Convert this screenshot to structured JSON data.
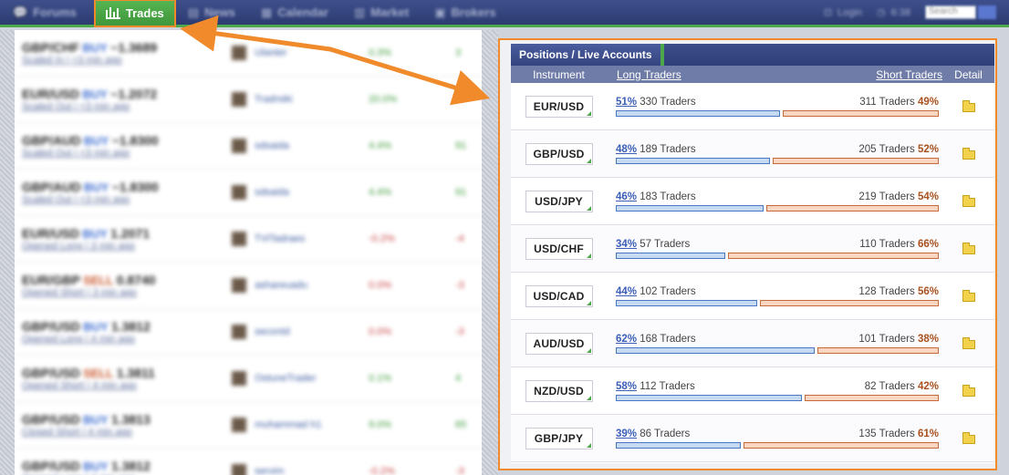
{
  "nav": {
    "items": [
      {
        "label": "Forums",
        "icon": "chat-icon",
        "active": false
      },
      {
        "label": "Trades",
        "icon": "bar-chart-icon",
        "active": true
      },
      {
        "label": "News",
        "icon": "news-icon",
        "active": false
      },
      {
        "label": "Calendar",
        "icon": "calendar-icon",
        "active": false
      },
      {
        "label": "Market",
        "icon": "market-icon",
        "active": false
      },
      {
        "label": "Brokers",
        "icon": "brokers-icon",
        "active": false
      }
    ],
    "login": "Login",
    "time": "6:38",
    "search_placeholder": "Search"
  },
  "feed": [
    {
      "pair": "GBP/CHF",
      "dir": "BUY",
      "price": "~1.3689",
      "sub": "Scaled In | <3 min ago",
      "user": "Ulanter",
      "pct": "0.3%",
      "pips": "3",
      "sign": "pos"
    },
    {
      "pair": "EUR/USD",
      "dir": "BUY",
      "price": "~1.2072",
      "sub": "Scaled Out | <3 min ago",
      "user": "Tradrsiki",
      "pct": "20.0%",
      "pips": "",
      "sign": "pos"
    },
    {
      "pair": "GBP/AUD",
      "dir": "BUY",
      "price": "~1.8300",
      "sub": "Scaled Out | <3 min ago",
      "user": "sdsaida",
      "pct": "4.4%",
      "pips": "91",
      "sign": "pos"
    },
    {
      "pair": "GBP/AUD",
      "dir": "BUY",
      "price": "~1.8300",
      "sub": "Scaled Out | <3 min ago",
      "user": "sdsaida",
      "pct": "4.4%",
      "pips": "91",
      "sign": "pos"
    },
    {
      "pair": "EUR/USD",
      "dir": "BUY",
      "price": "1.2071",
      "sub": "Opened Long | 3 min ago",
      "user": "TViTadraes",
      "pct": "-0.2%",
      "pips": "-4",
      "sign": "neg"
    },
    {
      "pair": "EUR/GBP",
      "dir": "SELL",
      "price": "0.8740",
      "sub": "Opened Short | 3 min ago",
      "user": "ashareuadu",
      "pct": "0.0%",
      "pips": "-3",
      "sign": "neg"
    },
    {
      "pair": "GBP/USD",
      "dir": "BUY",
      "price": "1.3812",
      "sub": "Opened Long | 4 min ago",
      "user": "secontd",
      "pct": "0.0%",
      "pips": "-3",
      "sign": "neg"
    },
    {
      "pair": "GBP/USD",
      "dir": "SELL",
      "price": "1.3811",
      "sub": "Opened Short | 4 min ago",
      "user": "OstuneTrader",
      "pct": "0.1%",
      "pips": "4",
      "sign": "pos"
    },
    {
      "pair": "GBP/USD",
      "dir": "BUY",
      "price": "1.3813",
      "sub": "Closed Short | 4 min ago",
      "user": "muhammad h1",
      "pct": "9.0%",
      "pips": "65",
      "sign": "pos"
    },
    {
      "pair": "GBP/USD",
      "dir": "BUY",
      "price": "1.3812",
      "sub": "Opened Long | 4 min ago",
      "user": "servim",
      "pct": "-0.2%",
      "pips": "-3",
      "sign": "neg"
    }
  ],
  "panel": {
    "title": "Positions / Live Accounts",
    "col_instrument": "Instrument",
    "col_long": "Long Traders",
    "col_short": "Short Traders",
    "col_detail": "Detail",
    "rows": [
      {
        "instrument": "EUR/USD",
        "long_pct": 51,
        "long_traders": "330 Traders",
        "short_traders": "311 Traders",
        "short_pct": 49
      },
      {
        "instrument": "GBP/USD",
        "long_pct": 48,
        "long_traders": "189 Traders",
        "short_traders": "205 Traders",
        "short_pct": 52
      },
      {
        "instrument": "USD/JPY",
        "long_pct": 46,
        "long_traders": "183 Traders",
        "short_traders": "219 Traders",
        "short_pct": 54
      },
      {
        "instrument": "USD/CHF",
        "long_pct": 34,
        "long_traders": "57 Traders",
        "short_traders": "110 Traders",
        "short_pct": 66
      },
      {
        "instrument": "USD/CAD",
        "long_pct": 44,
        "long_traders": "102 Traders",
        "short_traders": "128 Traders",
        "short_pct": 56
      },
      {
        "instrument": "AUD/USD",
        "long_pct": 62,
        "long_traders": "168 Traders",
        "short_traders": "101 Traders",
        "short_pct": 38
      },
      {
        "instrument": "NZD/USD",
        "long_pct": 58,
        "long_traders": "112 Traders",
        "short_traders": "82 Traders",
        "short_pct": 42
      },
      {
        "instrument": "GBP/JPY",
        "long_pct": 39,
        "long_traders": "86 Traders",
        "short_traders": "135 Traders",
        "short_pct": 61
      }
    ]
  },
  "colors": {
    "nav_bg": "#2c3b70",
    "active_tab": "#4ca84a",
    "annotation": "#f08a2a",
    "long_bar": "#c6daf2",
    "short_bar": "#f8d6c2",
    "long_text": "#3a5eb8",
    "short_text": "#a8501e"
  }
}
